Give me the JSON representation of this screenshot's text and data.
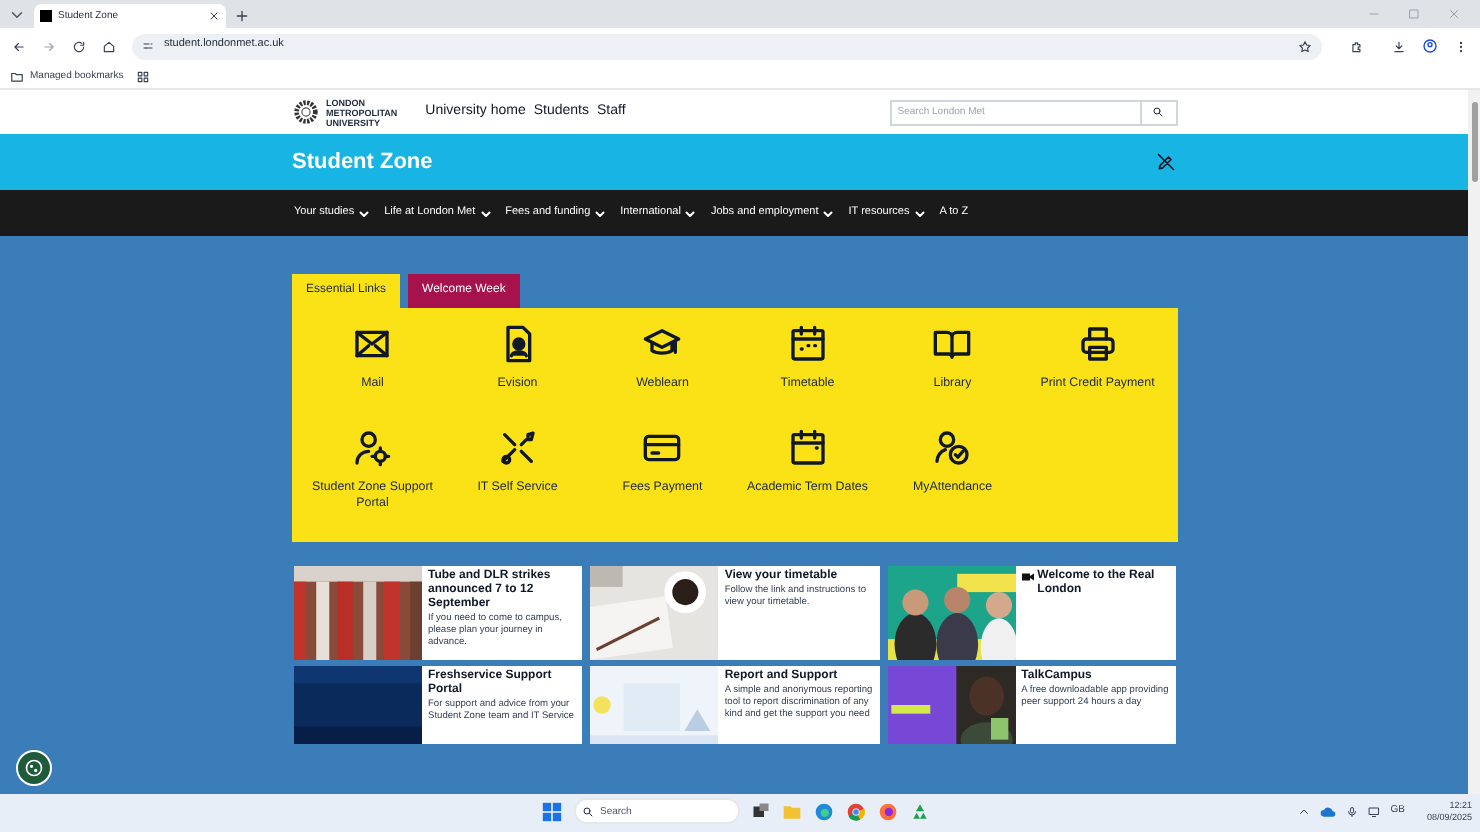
{
  "browser": {
    "tab_title": "Student Zone",
    "url": "student.londonmet.ac.uk",
    "bookmarks": "Managed bookmarks"
  },
  "header": {
    "logo": [
      "LONDON",
      "METROPOLITAN",
      "UNIVERSITY"
    ],
    "links": [
      "University home",
      "Students",
      "Staff"
    ],
    "search": {
      "placeholder": "Search London Met"
    }
  },
  "banner": {
    "title": "Student Zone"
  },
  "nav": [
    {
      "label": "Your studies",
      "dropdown": true
    },
    {
      "label": "Life at London Met",
      "dropdown": true
    },
    {
      "label": "Fees and funding",
      "dropdown": true
    },
    {
      "label": "International",
      "dropdown": true
    },
    {
      "label": "Jobs and employment",
      "dropdown": true
    },
    {
      "label": "IT resources",
      "dropdown": true
    },
    {
      "label": "A to Z",
      "dropdown": false
    }
  ],
  "tabs": [
    {
      "label": "Essential Links",
      "selected": true
    },
    {
      "label": "Welcome Week",
      "selected": false
    }
  ],
  "links": [
    "Mail",
    "Evision",
    "Weblearn",
    "Timetable",
    "Library",
    "Print Credit Payment",
    "Student Zone Support Portal",
    "IT Self Service",
    "Fees Payment",
    "Academic Term Dates",
    "MyAttendance"
  ],
  "cards": [
    {
      "title": "Tube and DLR strikes announced 7 to 12 September",
      "text": "If you need to come to campus, please plan your journey in advance.",
      "video": false
    },
    {
      "title": "View your timetable",
      "text": "Follow the link and instructions to view your timetable.",
      "video": false
    },
    {
      "title": "Welcome to the Real London",
      "video": true
    },
    {
      "title": "Freshservice Support Portal",
      "text": "For support and advice from your Student Zone team and IT Service",
      "video": false
    },
    {
      "title": "Report and Support",
      "text": "A simple and anonymous reporting tool to report discrimination of any kind and get the support you need",
      "video": false
    },
    {
      "title": "TalkCampus",
      "text": "A free downloadable app providing peer support 24 hours a day",
      "video": false
    }
  ],
  "taskbar": {
    "search": {
      "placeholder": "Search"
    },
    "language": "GB",
    "time": "12:21",
    "date": "08/09/2025"
  }
}
